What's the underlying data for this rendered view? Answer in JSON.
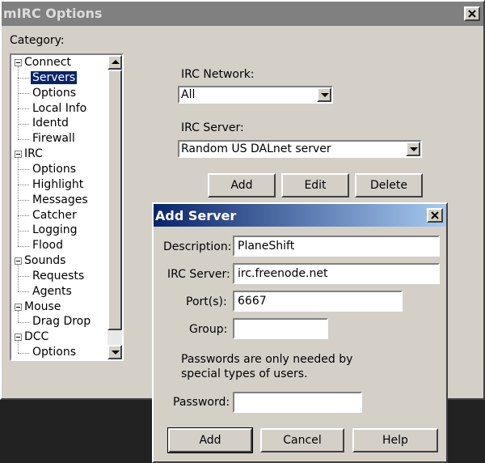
{
  "main_window": {
    "title": "mIRC Options",
    "category_label": "Category:",
    "tree": [
      {
        "label": "Connect",
        "level": 0,
        "expanded": true
      },
      {
        "label": "Servers",
        "level": 1,
        "selected": true
      },
      {
        "label": "Options",
        "level": 1
      },
      {
        "label": "Local Info",
        "level": 1
      },
      {
        "label": "Identd",
        "level": 1
      },
      {
        "label": "Firewall",
        "level": 1
      },
      {
        "label": "IRC",
        "level": 0,
        "expanded": true
      },
      {
        "label": "Options",
        "level": 1
      },
      {
        "label": "Highlight",
        "level": 1
      },
      {
        "label": "Messages",
        "level": 1
      },
      {
        "label": "Catcher",
        "level": 1
      },
      {
        "label": "Logging",
        "level": 1
      },
      {
        "label": "Flood",
        "level": 1
      },
      {
        "label": "Sounds",
        "level": 0,
        "expanded": true
      },
      {
        "label": "Requests",
        "level": 1
      },
      {
        "label": "Agents",
        "level": 1
      },
      {
        "label": "Mouse",
        "level": 0,
        "expanded": true
      },
      {
        "label": "Drag Drop",
        "level": 1
      },
      {
        "label": "DCC",
        "level": 0,
        "expanded": true
      },
      {
        "label": "Options",
        "level": 1
      }
    ],
    "network_label": "IRC Network:",
    "network_value": "All",
    "server_label": "IRC Server:",
    "server_value": "Random US DALnet server",
    "buttons": {
      "add": "Add",
      "edit": "Edit",
      "delete": "Delete"
    }
  },
  "add_server_dialog": {
    "title": "Add Server",
    "description_label": "Description:",
    "description_value": "PlaneShift",
    "server_label": "IRC Server:",
    "server_value": "irc.freenode.net",
    "ports_label": "Port(s):",
    "ports_value": "6667",
    "group_label": "Group:",
    "group_value": "",
    "password_note_line1": "Passwords are only needed by",
    "password_note_line2": "special types of users.",
    "password_label": "Password:",
    "password_value": "",
    "buttons": {
      "add": "Add",
      "cancel": "Cancel",
      "help": "Help"
    }
  }
}
